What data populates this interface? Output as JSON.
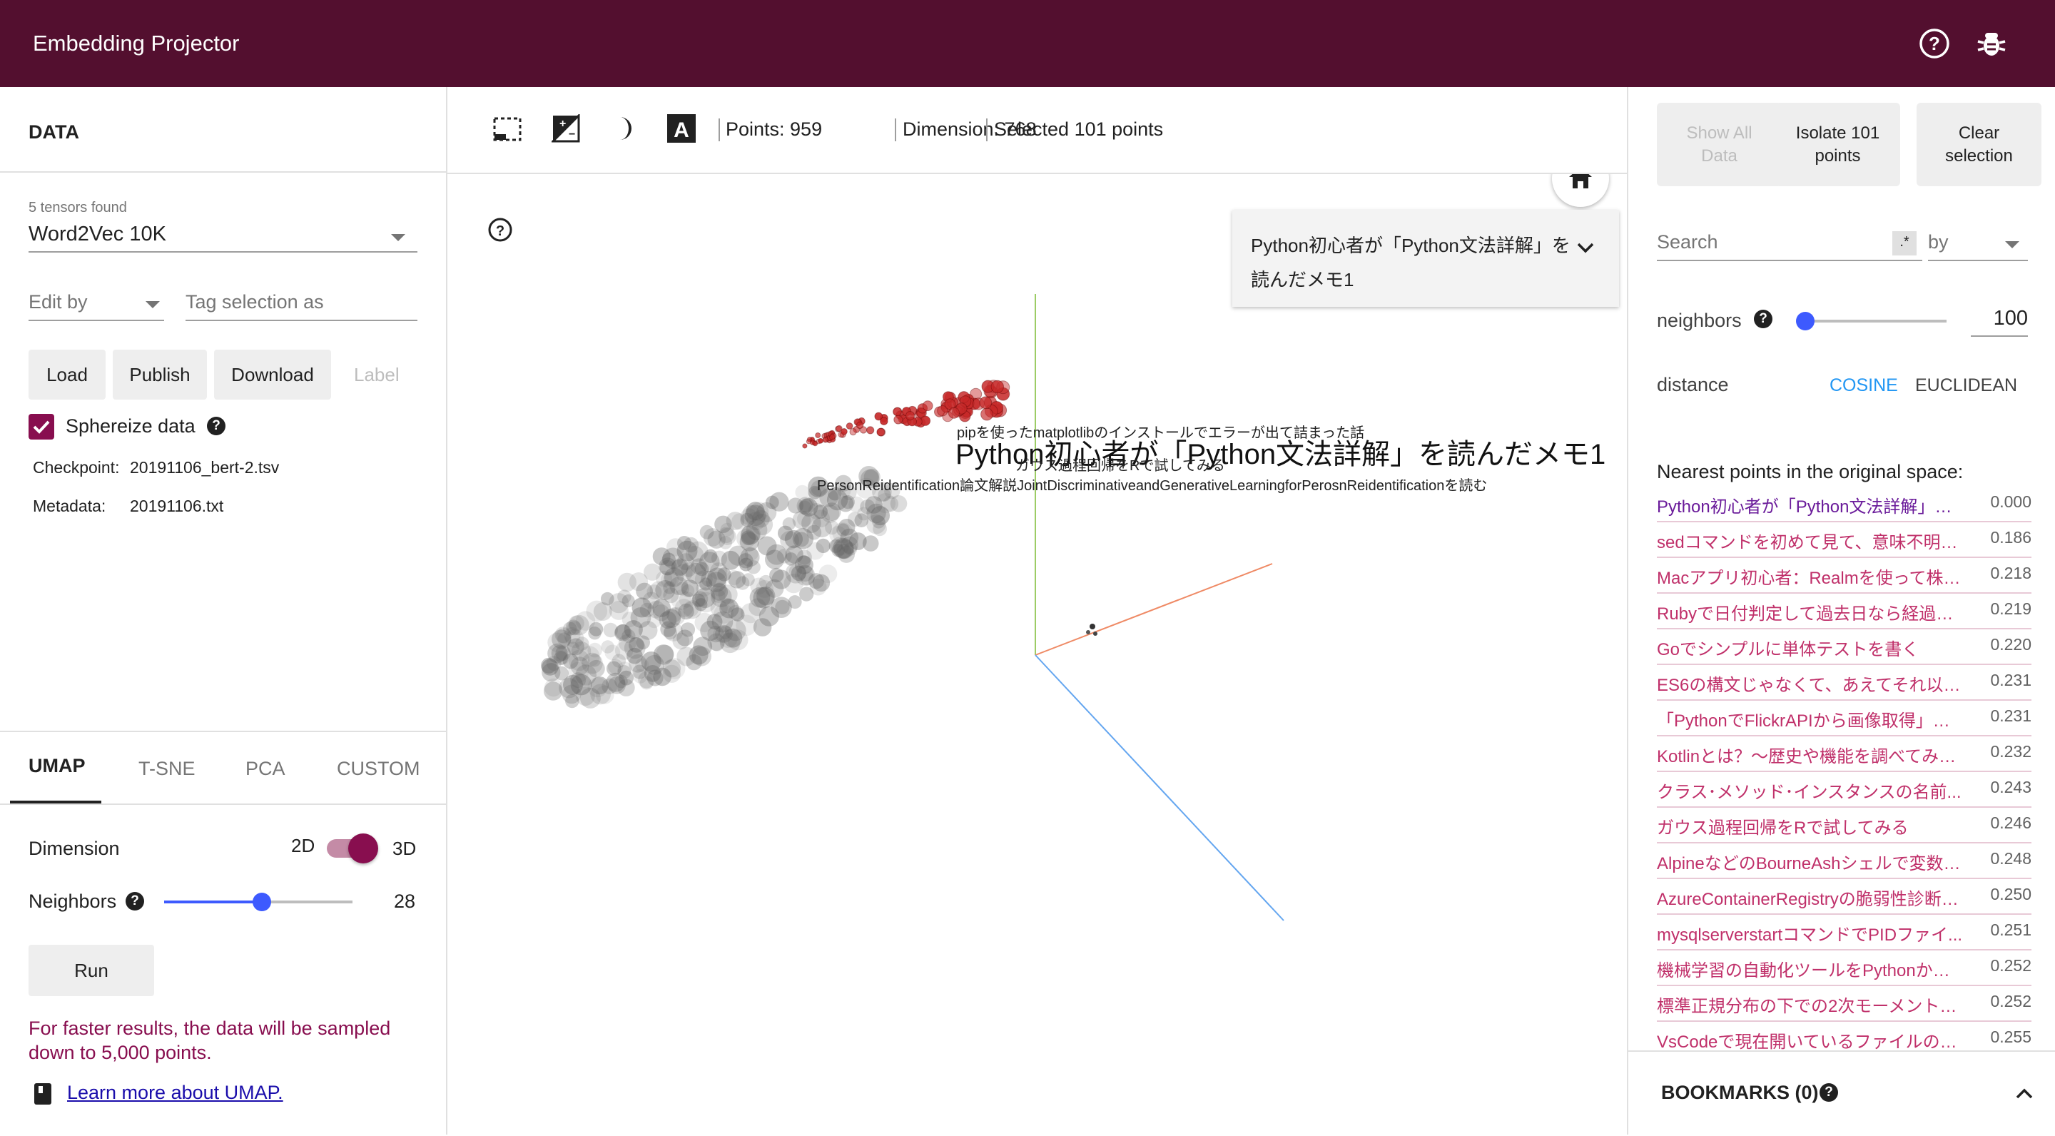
{
  "header": {
    "title": "Embedding Projector",
    "help_icon": "help-circle-icon",
    "bug_icon": "bug-icon"
  },
  "data_panel": {
    "heading": "DATA",
    "tensors_found": "5 tensors found",
    "tensor_selected": "Word2Vec 10K",
    "edit_by": "Edit by",
    "tag_placeholder": "Tag selection as",
    "buttons": {
      "load": "Load",
      "publish": "Publish",
      "download": "Download",
      "label": "Label"
    },
    "sphereize": "Sphereize data",
    "checkpoint_label": "Checkpoint:",
    "checkpoint_value": "20191106_bert-2.tsv",
    "metadata_label": "Metadata:",
    "metadata_value": "20191106.txt"
  },
  "projection": {
    "tabs": [
      "UMAP",
      "T-SNE",
      "PCA",
      "CUSTOM"
    ],
    "active_tab": "UMAP",
    "dimension_label": "Dimension",
    "dim_2d": "2D",
    "dim_3d": "3D",
    "neighbors_label": "Neighbors",
    "neighbors_value": "28",
    "neighbors_fraction": 0.52,
    "run": "Run",
    "notice": "For faster results, the data will be sampled down to 5,000 points.",
    "learn_more": "Learn more about UMAP."
  },
  "toolbar": {
    "points": "Points: 959",
    "dimension": "Dimension: 768",
    "selected": "Selected 101 points"
  },
  "canvas": {
    "selected_title": "Python初心者が「Python文法詳解」を読んだメモ1",
    "big_label": "Python初心者が「Python文法詳解」を読んだメモ1",
    "labels": [
      "pipを使ったmatplotlibのインストールでエラーが出て詰まった話",
      "ガウス過程回帰をRで試してみる",
      "PersonReidentification論文解説JointDiscriminativeandGenerativeLearningforPerosnReidentificationを読む"
    ],
    "colors": {
      "selected": "#c62828",
      "unselected": "#616161"
    }
  },
  "inspector": {
    "show_all": "Show All Data",
    "isolate": "Isolate 101 points",
    "clear": "Clear selection",
    "search_placeholder": "Search",
    "regex": ".*",
    "by": "by",
    "neighbors_label": "neighbors",
    "neighbors_value": "100",
    "neighbors_fraction": 0.05,
    "distance_label": "distance",
    "cosine": "COSINE",
    "euclidean": "EUCLIDEAN",
    "nearest_heading": "Nearest points in the original space:",
    "nearest": [
      {
        "label": "Python初心者が「Python文法詳解」を...",
        "value": "0.000"
      },
      {
        "label": "sedコマンドを初めて見て、意味不明だ...",
        "value": "0.186"
      },
      {
        "label": "Macアプリ初心者：Realmを使って株価...",
        "value": "0.218"
      },
      {
        "label": "Rubyで日付判定して過去日なら経過日...",
        "value": "0.219"
      },
      {
        "label": "Goでシンプルに単体テストを書く",
        "value": "0.220"
      },
      {
        "label": "ES6の構文じゃなくて、あえてそれ以前...",
        "value": "0.231"
      },
      {
        "label": "「PythonでFlickrAPIから画像取得」に...",
        "value": "0.231"
      },
      {
        "label": "Kotlinとは？〜歴史や機能を調べてみた...",
        "value": "0.232"
      },
      {
        "label": "クラス･メソッド･インスタンスの名前...",
        "value": "0.243"
      },
      {
        "label": "ガウス過程回帰をRで試してみる",
        "value": "0.246"
      },
      {
        "label": "AlpineなどのBourneAshシェルで変数・...",
        "value": "0.248"
      },
      {
        "label": "AzureContainerRegistryの脆弱性診断を...",
        "value": "0.250"
      },
      {
        "label": "mysqlserverstartコマンドでPIDファイ...",
        "value": "0.251"
      },
      {
        "label": "機械学習の自動化ツールをPythonから...",
        "value": "0.252"
      },
      {
        "label": "標準正規分布の下での2次モーメントの...",
        "value": "0.252"
      },
      {
        "label": "VsCodeで現在開いているファイルの絶...",
        "value": "0.255"
      }
    ],
    "bookmarks": "BOOKMARKS (0)"
  },
  "colors": {
    "header": "#530f2f",
    "accent": "#880e4f",
    "link": "#c0306a",
    "slider": "#3d5afe",
    "cosine": "#2196f3"
  }
}
